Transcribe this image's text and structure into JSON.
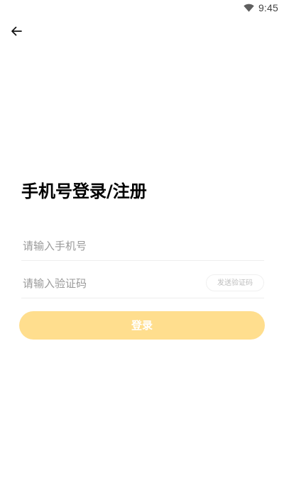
{
  "status_bar": {
    "time": "9:45",
    "wifi_icon": "wifi-icon"
  },
  "nav": {
    "back_icon": "arrow-left-icon"
  },
  "title": "手机号登录/注册",
  "phone_field": {
    "value": "",
    "placeholder": "请输入手机号"
  },
  "code_field": {
    "value": "",
    "placeholder": "请输入验证码"
  },
  "send_code_label": "发送验证码",
  "login_label": "登录",
  "colors": {
    "login_button_bg": "#ffde8e",
    "login_button_text": "#ffffff",
    "placeholder_text": "#9a9a9a",
    "divider": "#eeeeee"
  }
}
